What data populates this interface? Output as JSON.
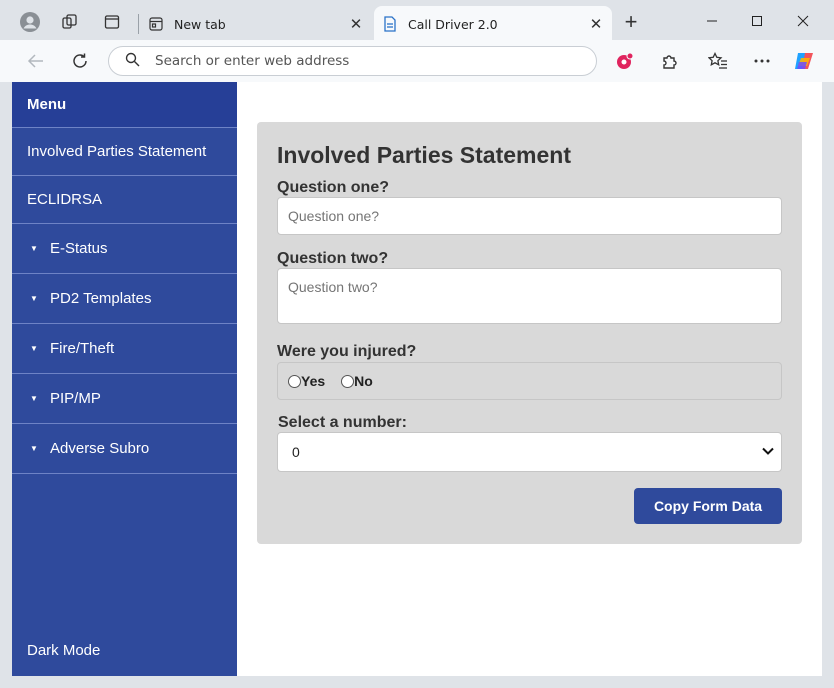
{
  "browser": {
    "tabs": [
      {
        "title": "New tab",
        "active": false
      },
      {
        "title": "Call Driver 2.0",
        "active": true
      }
    ],
    "address_placeholder": "Search or enter web address",
    "new_tab_symbol": "+",
    "close_symbol": "✕"
  },
  "sidebar": {
    "menu_title": "Menu",
    "items": [
      {
        "label": "Involved Parties Statement",
        "expandable": false
      },
      {
        "label": "ECLIDRSA",
        "expandable": false
      },
      {
        "label": "E-Status",
        "expandable": true
      },
      {
        "label": "PD2 Templates",
        "expandable": true
      },
      {
        "label": "Fire/Theft",
        "expandable": true
      },
      {
        "label": "PIP/MP",
        "expandable": true
      },
      {
        "label": "Adverse Subro",
        "expandable": true
      }
    ],
    "caret": "▼",
    "dark_mode_label": "Dark Mode"
  },
  "form": {
    "title": "Involved Parties Statement",
    "q1": {
      "label": "Question one?",
      "placeholder": "Question one?"
    },
    "q2": {
      "label": "Question two?",
      "placeholder": "Question two?"
    },
    "injured": {
      "label": "Were you injured?",
      "options": [
        "Yes",
        "No"
      ]
    },
    "number": {
      "label": "Select a number:",
      "selected": "0"
    },
    "copy_button": "Copy Form Data"
  },
  "colors": {
    "sidebar_bg": "#2f4a9c",
    "sidebar_header_bg": "#263f97",
    "form_bg": "#d9d9d9",
    "button_bg": "#2f4a9c"
  }
}
